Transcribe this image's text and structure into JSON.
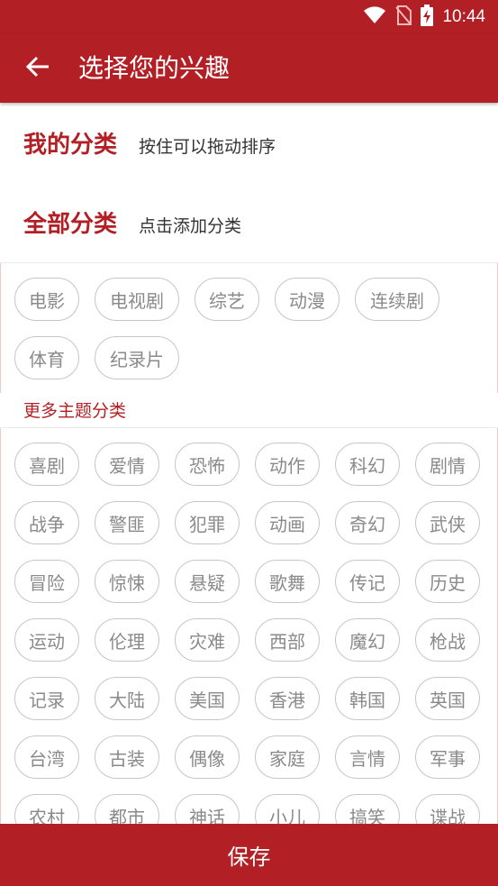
{
  "status_bar": {
    "time": "10:44",
    "icons": [
      "wifi-icon",
      "no-sim-icon",
      "battery-charging-icon"
    ]
  },
  "app_bar": {
    "back_icon": "arrow-left-icon",
    "title": "选择您的兴趣"
  },
  "my_categories": {
    "title": "我的分类",
    "hint": "按住可以拖动排序"
  },
  "all_categories": {
    "title": "全部分类",
    "hint": "点击添加分类",
    "items": [
      "电影",
      "电视剧",
      "综艺",
      "动漫",
      "连续剧",
      "体育",
      "纪录片"
    ]
  },
  "more_topics": {
    "label": "更多主题分类",
    "items": [
      "喜剧",
      "爱情",
      "恐怖",
      "动作",
      "科幻",
      "剧情",
      "战争",
      "警匪",
      "犯罪",
      "动画",
      "奇幻",
      "武侠",
      "冒险",
      "惊悚",
      "悬疑",
      "歌舞",
      "传记",
      "历史",
      "运动",
      "伦理",
      "灾难",
      "西部",
      "魔幻",
      "枪战",
      "记录",
      "大陆",
      "美国",
      "香港",
      "韩国",
      "英国",
      "台湾",
      "古装",
      "偶像",
      "家庭",
      "言情",
      "军事",
      "农村",
      "都市",
      "神话",
      "小儿",
      "搞笑",
      "谍战"
    ]
  },
  "footer": {
    "save_label": "保存"
  },
  "colors": {
    "primary": "#b21f24",
    "chip_border": "#c6c6c6",
    "chip_text": "#8a8a8a"
  }
}
